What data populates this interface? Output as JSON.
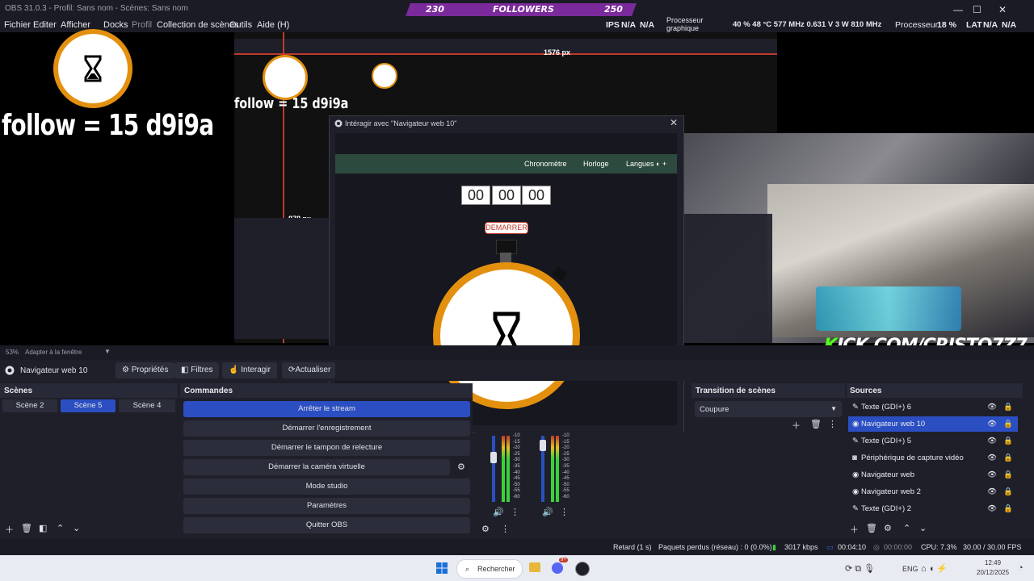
{
  "window": {
    "title": "OBS 31.0.3 - Profil: Sans nom - Scènes: Sans nom",
    "min": "—",
    "max": "☐",
    "close": "✕"
  },
  "banner": {
    "left": "230",
    "center": "FOLLOWERS",
    "right": "250"
  },
  "menu": [
    "Fichier",
    "Editer",
    "Afficher",
    "Docks",
    "Profil",
    "Collection de scènes",
    "Outils",
    "Aide (H)"
  ],
  "stats": {
    "ips": "IPS",
    "ips_val1": "N/A",
    "ips_val2": "N/A",
    "gpu_label": "Processeur graphique",
    "gpu_vals": "40 % 48 °C 577 MHz 0.631 V 3 W 810 MHz",
    "cpu_label": "Processeur",
    "cpu_val": "18 %",
    "lat_label": "LAT",
    "lat_val1": "N/A",
    "lat_val2": "N/A"
  },
  "preview": {
    "follow_text": "follow = 15 d9i9a",
    "kick_k": "K",
    "kick_rest": "ICK.COM/CRISTO7Z7",
    "zoom_pct": "53%",
    "zoom_mode": "Adapter à la fenêtre",
    "px_label1": "1576 px",
    "px_label2": "878 px"
  },
  "dialog": {
    "title": "Intéragir avec \"Navigateur web 10\"",
    "close": "✕",
    "nav": [
      "Chronomètre",
      "Horloge",
      "Langues ◐ +"
    ],
    "time": [
      "00",
      "00",
      "00"
    ],
    "start": "DEMARRER"
  },
  "source_toolbar": {
    "source_name": "Navigateur web 10",
    "properties": "Propriétés",
    "filters": "Filtres",
    "interact": "Interagir",
    "refresh": "Actualiser"
  },
  "scenes": {
    "header": "Scènes",
    "items": [
      "Scène 2",
      "Scène 5",
      "Scène 4"
    ],
    "active": 1
  },
  "commands": {
    "header": "Commandes",
    "items": [
      "Arrêter le stream",
      "Démarrer l'enregistrement",
      "Démarrer le tampon de relecture",
      "Démarrer la caméra virtuelle",
      "Mode studio",
      "Paramètres",
      "Quitter OBS"
    ]
  },
  "mixer": {
    "scale": [
      "-10",
      "-15",
      "-20",
      "-25",
      "-30",
      "-35",
      "-40",
      "-45",
      "-50",
      "-55",
      "-60"
    ]
  },
  "transition": {
    "header": "Transition de scènes",
    "value": "Coupure"
  },
  "sources": {
    "header": "Sources",
    "items": [
      "Texte (GDI+) 6",
      "Navigateur web 10",
      "Texte (GDI+) 5",
      "Périphérique de capture vidéo",
      "Navigateur web",
      "Navigateur web 2",
      "Texte (GDI+) 2"
    ],
    "active": 1
  },
  "status": {
    "delay": "Retard (1 s)",
    "dropped": "Paquets perdus (réseau) : 0 (0.0%)",
    "bitrate": "3017 kbps",
    "stream_time": "00:04:10",
    "rec_time": "00:00:00",
    "cpu": "CPU: 7.3%",
    "fps": "30.00 / 30.00 FPS"
  },
  "taskbar": {
    "search": "Rechercher",
    "lang": "ENG",
    "time": "12:49",
    "date": "20/12/2025",
    "badge": "9+"
  },
  "colors": {
    "accent_blue": "#2b4fc2",
    "timer_orange": "#e3900f",
    "banner_purple": "#7b2a9b",
    "kick_green": "#53fc18"
  }
}
